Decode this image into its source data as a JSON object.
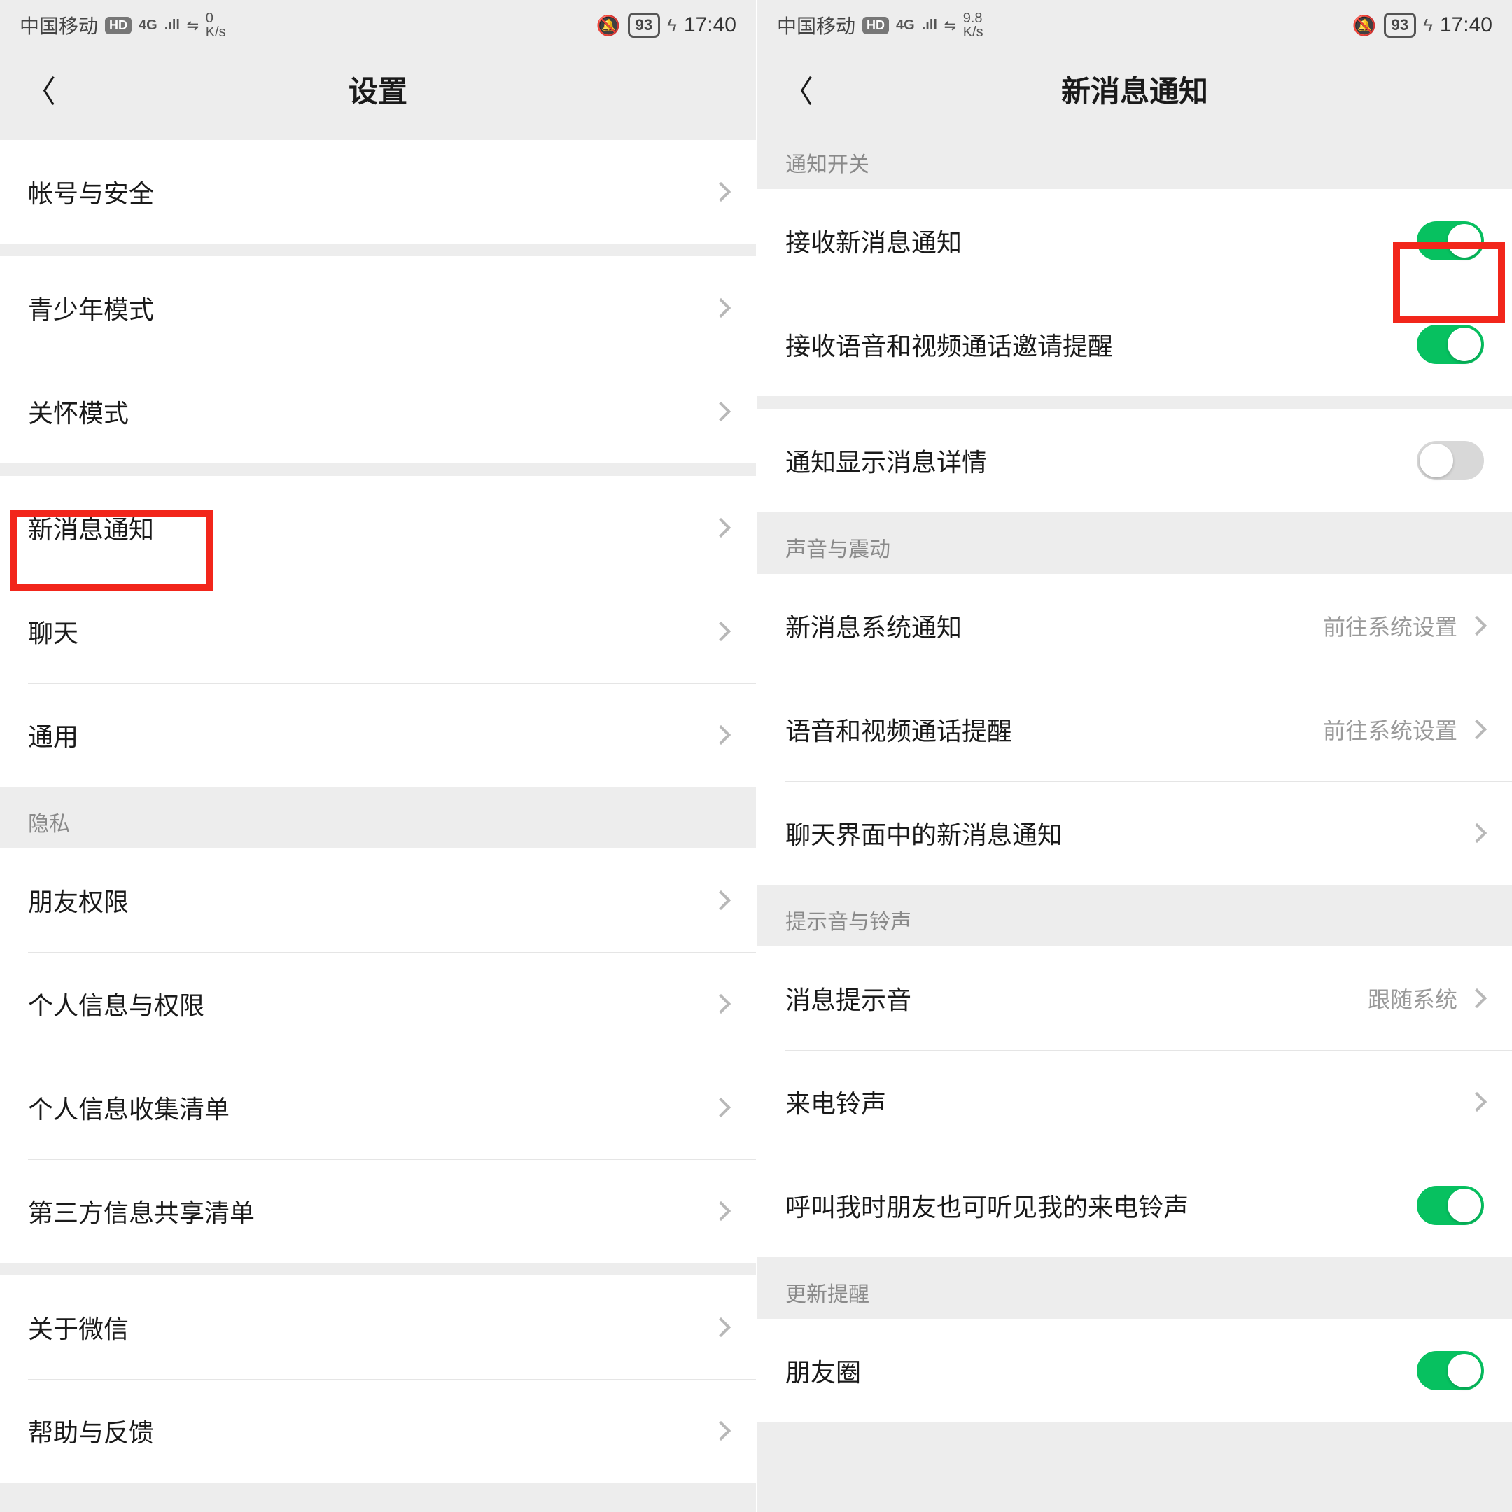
{
  "status": {
    "carrier": "中国移动",
    "hd": "HD",
    "net": "4G",
    "kbs_left": "0",
    "kbs_right": "9.8",
    "kbs_unit": "K/s",
    "battery": "93",
    "time": "17:40"
  },
  "left": {
    "title": "设置",
    "rows": {
      "account": "帐号与安全",
      "youth": "青少年模式",
      "care": "关怀模式",
      "new_msg": "新消息通知",
      "chat": "聊天",
      "general": "通用"
    },
    "privacy_header": "隐私",
    "privacy": {
      "friend_perm": "朋友权限",
      "personal_info": "个人信息与权限",
      "collect_list": "个人信息收集清单",
      "third_party": "第三方信息共享清单"
    },
    "about": "关于微信",
    "help": "帮助与反馈"
  },
  "right": {
    "title": "新消息通知",
    "sec_switch": "通知开关",
    "switches": {
      "receive_new": "接收新消息通知",
      "receive_call": "接收语音和视频通话邀请提醒",
      "show_detail": "通知显示消息详情"
    },
    "sec_sound": "声音与震动",
    "sound": {
      "sys_notify": {
        "label": "新消息系统通知",
        "value": "前往系统设置"
      },
      "call_remind": {
        "label": "语音和视频通话提醒",
        "value": "前往系统设置"
      },
      "in_chat": "聊天界面中的新消息通知"
    },
    "sec_tone": "提示音与铃声",
    "tone": {
      "msg_tone": {
        "label": "消息提示音",
        "value": "跟随系统"
      },
      "ringtone": "来电铃声",
      "friend_hear": "呼叫我时朋友也可听见我的来电铃声"
    },
    "sec_update": "更新提醒",
    "moments": "朋友圈"
  }
}
